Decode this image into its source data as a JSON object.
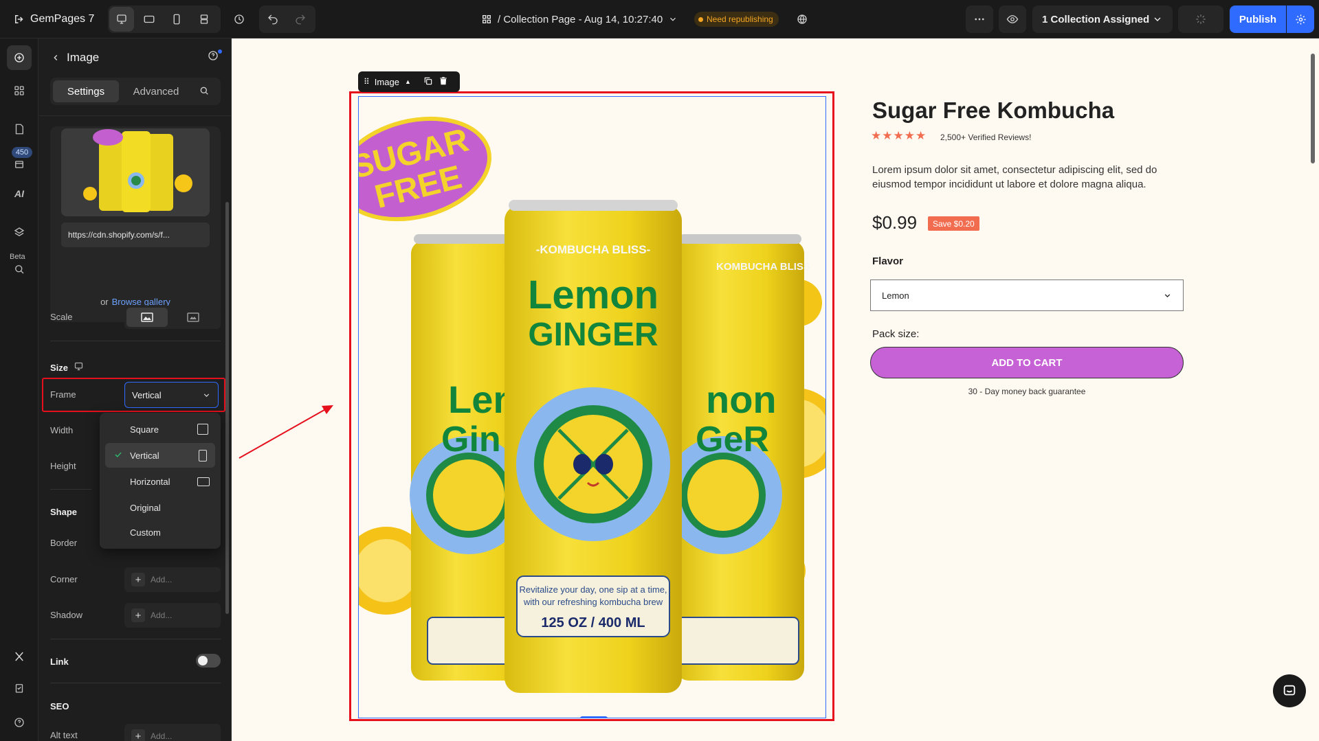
{
  "app": {
    "name": "GemPages 7"
  },
  "topbar": {
    "page_title": "/ Collection Page - Aug 14, 10:27:40",
    "status_badge": "Need republishing",
    "collection_assigned": "1 Collection Assigned",
    "publish_label": "Publish"
  },
  "rail": {
    "badge_count": "450",
    "ai_label": "AI",
    "beta_label": "Beta"
  },
  "panel": {
    "title": "Image",
    "tabs": {
      "settings": "Settings",
      "advanced": "Advanced"
    },
    "image_url": "https://cdn.shopify.com/s/f...",
    "or_text": "or",
    "browse_gallery": "Browse gallery",
    "scale_label": "Scale",
    "size_heading": "Size",
    "frame_label": "Frame",
    "frame_value": "Vertical",
    "width_label": "Width",
    "height_label": "Height",
    "shape_heading": "Shape",
    "border_label": "Border",
    "corner_label": "Corner",
    "shadow_label": "Shadow",
    "add_placeholder": "Add...",
    "link_heading": "Link",
    "link_toggle_on": false,
    "seo_heading": "SEO",
    "alt_text_label": "Alt text",
    "frame_options": [
      {
        "label": "Square",
        "selected": false
      },
      {
        "label": "Vertical",
        "selected": true
      },
      {
        "label": "Horizontal",
        "selected": false
      },
      {
        "label": "Original",
        "selected": false
      },
      {
        "label": "Custom",
        "selected": false
      }
    ]
  },
  "canvas": {
    "element_toolbar_label": "Image",
    "product_title": "Sugar Free Kombucha",
    "rating_stars": 5,
    "reviews_text": "2,500+ Verified Reviews!",
    "description": "Lorem ipsum dolor sit amet, consectetur adipiscing elit, sed do eiusmod tempor incididunt ut labore et dolore magna aliqua.",
    "price": "$0.99",
    "save_badge": "Save $0.20",
    "flavor_label": "Flavor",
    "flavor_value": "Lemon",
    "pack_size_label": "Pack size:",
    "add_to_cart": "ADD TO CART",
    "guarantee": "30 - Day money back guarantee",
    "product_image": {
      "sticker_line1": "SUGAR",
      "sticker_line2": "FREE",
      "brand": "-KOMBUCHA BLISS-",
      "brand_side": "KOMBUCHA BLISS",
      "flavor_line1": "Lemon",
      "flavor_line2": "GINGER",
      "tagline_line1": "Revitalize your day, one sip at a time,",
      "tagline_line2": "with our refreshing kombucha brew",
      "volume": "125 OZ / 400 ML"
    }
  },
  "colors": {
    "accent_blue": "#2f6bff",
    "cart_purple": "#c661d6",
    "highlight_red": "#e5101c",
    "star_orange": "#f26d4f",
    "badge_amber": "#f5a623",
    "canvas_bg": "#fffaf1"
  }
}
